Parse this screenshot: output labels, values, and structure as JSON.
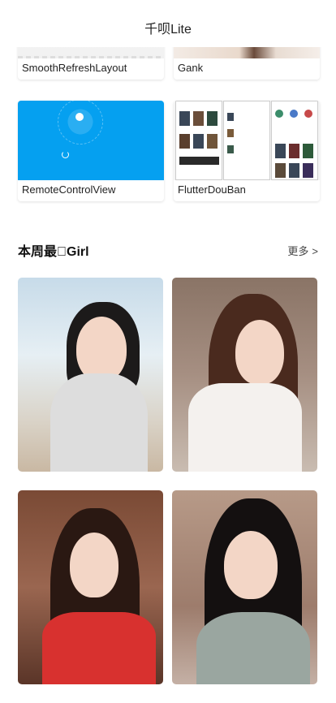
{
  "app_bar": {
    "title": "千呗Lite"
  },
  "projects": [
    {
      "label": "SmoothRefreshLayout"
    },
    {
      "label": "Gank"
    },
    {
      "label": "RemoteControlView"
    },
    {
      "label": "FlutterDouBan"
    }
  ],
  "section": {
    "title": "本周最\u0000Girl",
    "more_label": "更多",
    "more_icon": "chevron-right-icon"
  },
  "photos": [
    {
      "icon": "girl-photo"
    },
    {
      "icon": "girl-photo"
    },
    {
      "icon": "girl-photo"
    },
    {
      "icon": "girl-photo"
    }
  ],
  "colors": {
    "remote_blue": "#05a0f0",
    "text": "#222222"
  }
}
